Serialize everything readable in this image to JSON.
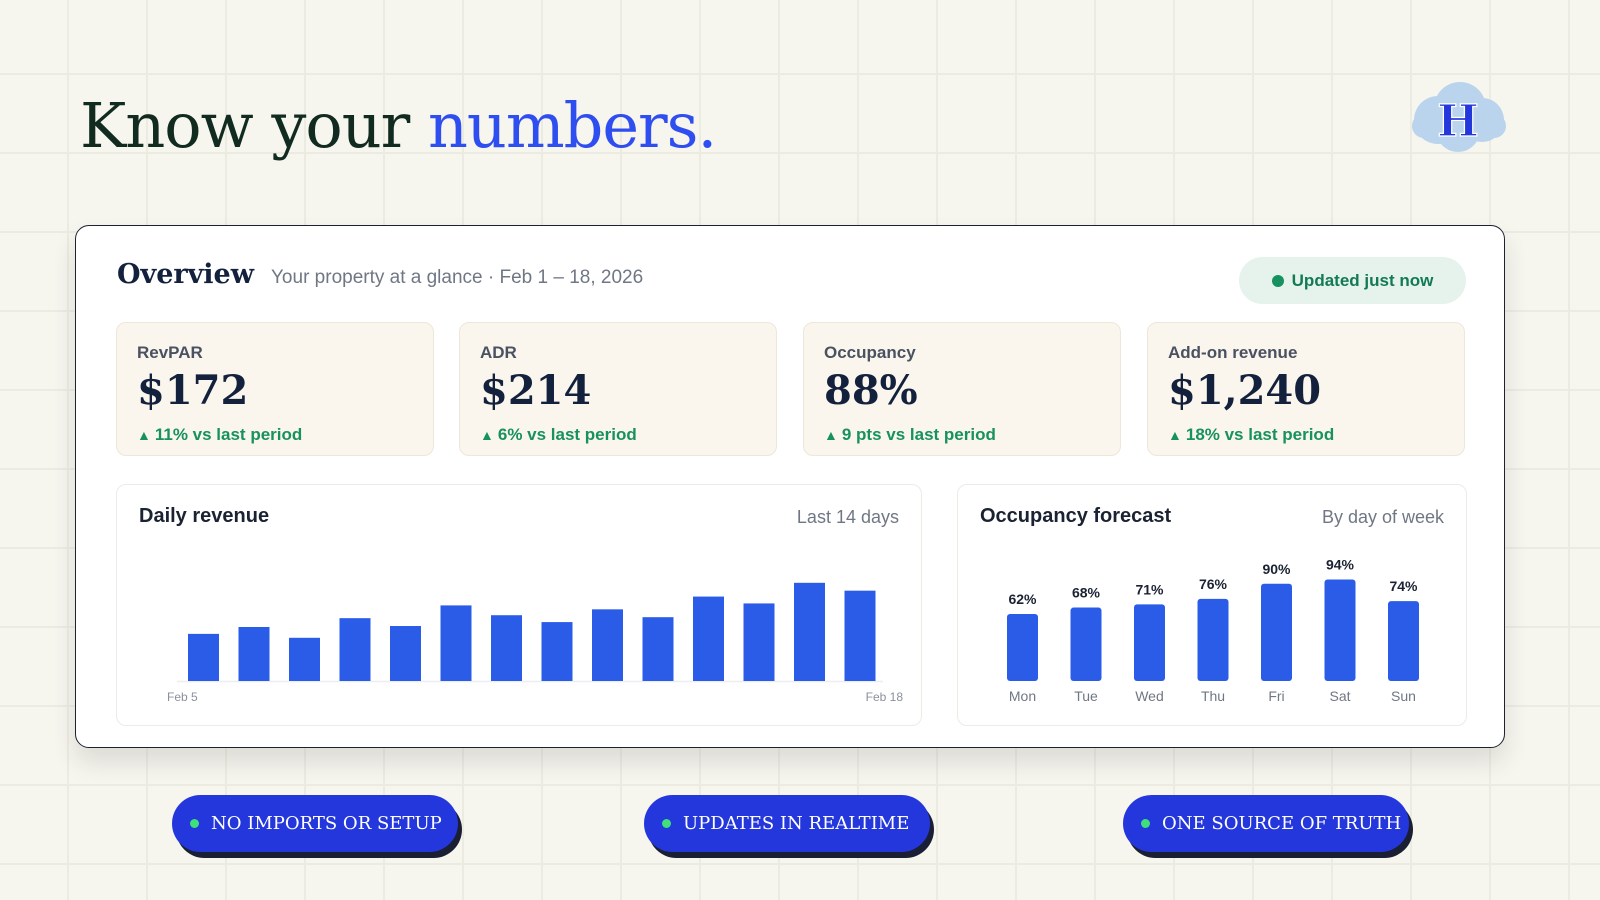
{
  "headline": {
    "prefix": "Know your ",
    "accent": "numbers."
  },
  "logo": {
    "letter": "H",
    "icon": "cloud-logo-icon"
  },
  "overview": {
    "title": "Overview",
    "subtitle": "Your property at a glance · Feb 1 – 18, 2026",
    "status": "Updated just now"
  },
  "kpis": [
    {
      "label": "RevPAR",
      "value": "$172",
      "delta": "11% vs last period"
    },
    {
      "label": "ADR",
      "value": "$214",
      "delta": "6% vs last period"
    },
    {
      "label": "Occupancy",
      "value": "88%",
      "delta": "9 pts vs last period"
    },
    {
      "label": "Add-on revenue",
      "value": "$1,240",
      "delta": "18% vs last period"
    }
  ],
  "daily_revenue": {
    "title": "Daily revenue",
    "note": "Last 14 days"
  },
  "occupancy_forecast": {
    "title": "Occupancy forecast",
    "note": "By day of week"
  },
  "pills": [
    "NO IMPORTS OR SETUP",
    "UPDATES IN REALTIME",
    "ONE SOURCE OF TRUTH"
  ],
  "colors": {
    "accent": "#2f4ef0",
    "bar": "#2a5ce8",
    "positive": "#17915f",
    "pill": "#2437dc"
  },
  "chart_data": [
    {
      "type": "bar",
      "title": "Daily revenue",
      "x_tick_labels": [
        "Feb 5",
        "Feb 18"
      ],
      "values": [
        48,
        55,
        44,
        64,
        56,
        77,
        67,
        60,
        73,
        65,
        86,
        79,
        100,
        92
      ],
      "ylim": [
        0,
        110
      ],
      "grid": false
    },
    {
      "type": "bar",
      "title": "Occupancy forecast",
      "categories": [
        "Mon",
        "Tue",
        "Wed",
        "Thu",
        "Fri",
        "Sat",
        "Sun"
      ],
      "values": [
        62,
        68,
        71,
        76,
        90,
        94,
        74
      ],
      "data_labels": [
        "62%",
        "68%",
        "71%",
        "76%",
        "90%",
        "94%",
        "74%"
      ],
      "ylim": [
        0,
        100
      ],
      "grid": false
    }
  ]
}
